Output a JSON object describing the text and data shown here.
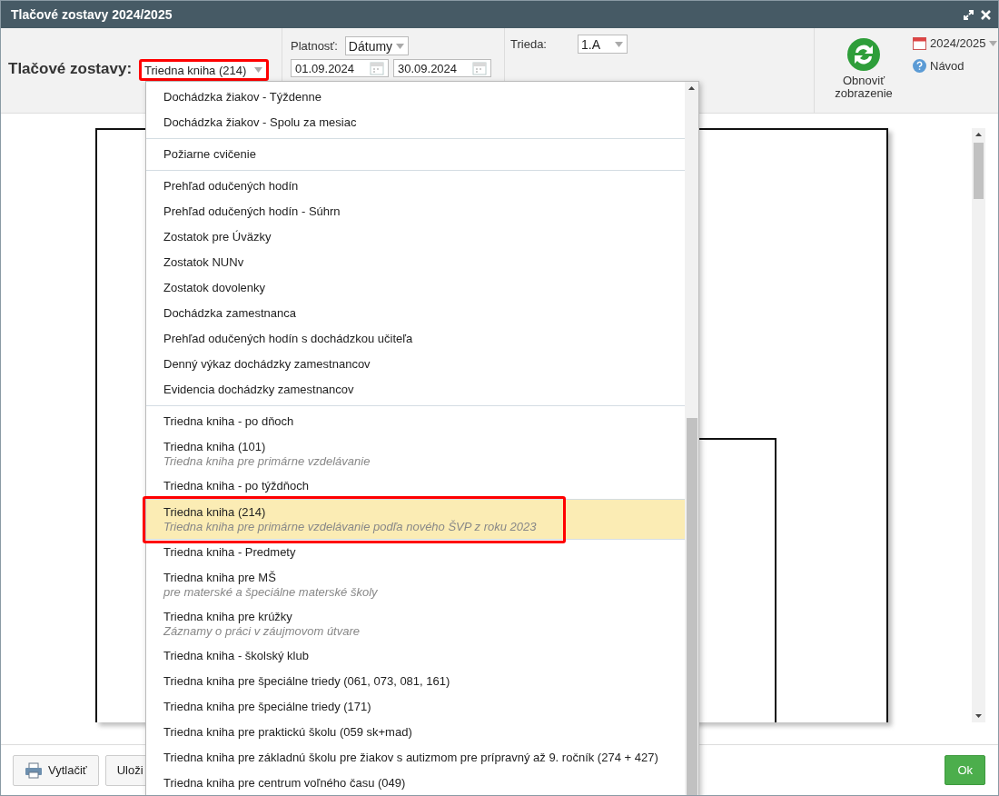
{
  "window": {
    "title": "Tlačové zostavy 2024/2025"
  },
  "toolbar": {
    "label": "Tlačové zostavy:",
    "report_select": {
      "value": "Triedna kniha (214)",
      "highlighted": true
    },
    "validity": {
      "label": "Platnosť:",
      "mode": "Dátumy",
      "date_from": "01.09.2024",
      "date_to": "30.09.2024"
    },
    "class": {
      "label": "Trieda:",
      "value": "1.A"
    },
    "refresh_button": "Obnoviť zobrazenie",
    "year": "2024/2025",
    "help_link": "Návod"
  },
  "dropdown": {
    "groups": [
      {
        "items": [
          {
            "title": "Dochádzka žiakov - Týždenne",
            "selected": false
          },
          {
            "title": "Dochádzka žiakov - Spolu za mesiac",
            "selected": false
          }
        ]
      },
      {
        "items": [
          {
            "title": "Požiarne cvičenie",
            "selected": false
          }
        ]
      },
      {
        "items": [
          {
            "title": "Prehľad odučených hodín",
            "selected": false
          },
          {
            "title": "Prehľad odučených hodín - Súhrn",
            "selected": false
          },
          {
            "title": "Zostatok pre Úväzky",
            "selected": false
          },
          {
            "title": "Zostatok NUNv",
            "selected": false
          },
          {
            "title": "Zostatok dovolenky",
            "selected": false
          },
          {
            "title": "Dochádzka zamestnanca",
            "selected": false
          },
          {
            "title": "Prehľad odučených hodín s dochádzkou učiteľa",
            "selected": false
          },
          {
            "title": "Denný výkaz dochádzky zamestnancov",
            "selected": false
          },
          {
            "title": "Evidencia dochádzky zamestnancov",
            "selected": false
          }
        ]
      },
      {
        "items": [
          {
            "title": "Triedna kniha - po dňoch",
            "selected": false
          },
          {
            "title": "Triedna kniha (101)",
            "subtitle": "Triedna kniha pre primárne vzdelávanie",
            "selected": false
          },
          {
            "title": "Triedna kniha - po týždňoch",
            "selected": false
          },
          {
            "title": "Triedna kniha (214)",
            "subtitle": "Triedna kniha pre primárne vzdelávanie podľa nového ŠVP z roku 2023",
            "selected": true,
            "highlighted": true
          },
          {
            "title": "Triedna kniha - Predmety",
            "selected": false
          },
          {
            "title": "Triedna kniha pre MŠ",
            "subtitle": "pre materské a špeciálne materské školy",
            "selected": false
          },
          {
            "title": "Triedna kniha pre krúžky",
            "subtitle": "Záznamy o práci v záujmovom útvare",
            "selected": false
          },
          {
            "title": "Triedna kniha - školský klub",
            "selected": false
          },
          {
            "title": "Triedna kniha pre špeciálne triedy (061, 073, 081, 161)",
            "selected": false
          },
          {
            "title": "Triedna kniha pre špeciálne triedy (171)",
            "selected": false
          },
          {
            "title": "Triedna kniha pre praktickú školu (059 sk+mad)",
            "selected": false
          },
          {
            "title": "Triedna kniha pre základnú školu pre žiakov s autizmom pre prípravný až 9. ročník (274 + 427)",
            "selected": false
          },
          {
            "title": "Triedna kniha pre centrum voľného času (049)",
            "selected": false
          }
        ]
      }
    ]
  },
  "footer": {
    "buttons": [
      {
        "label": "Vytlačiť",
        "kind": "print"
      },
      {
        "label": "Uloži",
        "kind": "plain"
      }
    ],
    "ok_button": "Ok"
  }
}
